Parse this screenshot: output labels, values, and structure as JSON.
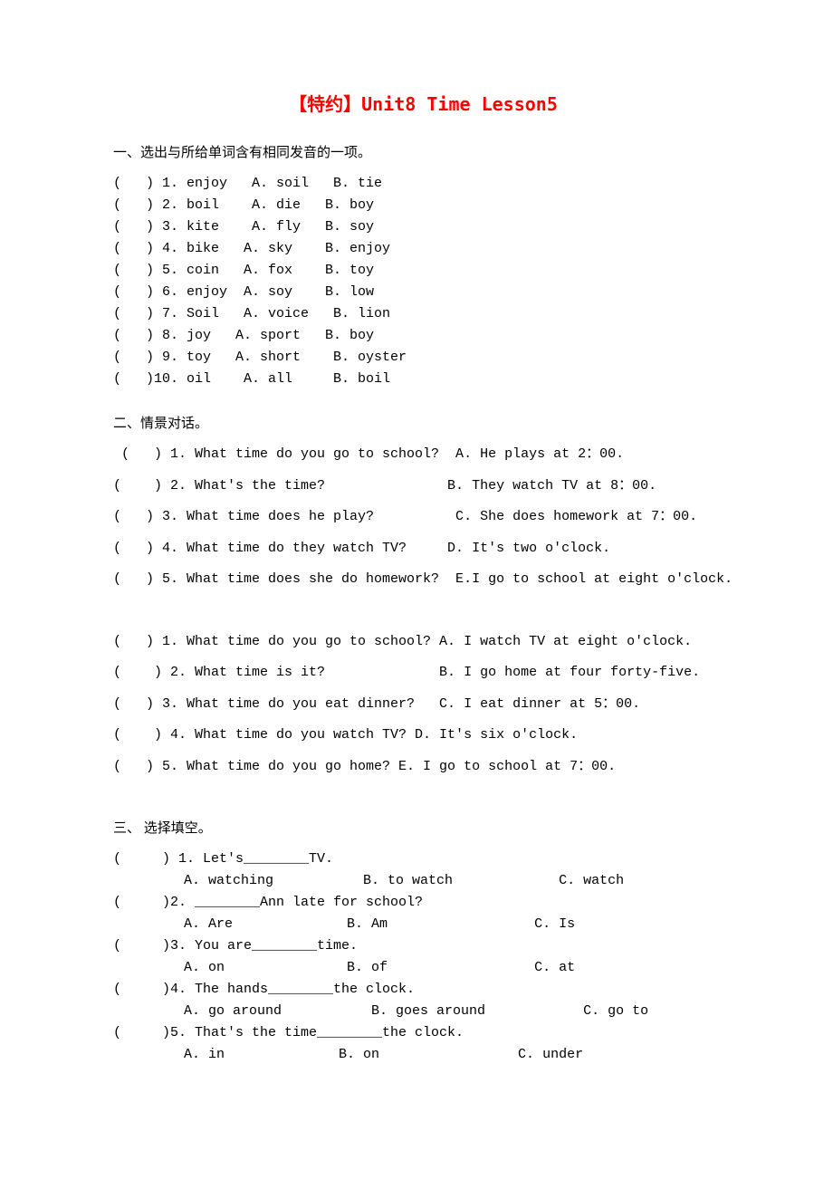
{
  "title": "【特约】Unit8 Time Lesson5",
  "section1": {
    "heading": "一、选出与所给单词含有相同发音的一项。",
    "rows": [
      "(   ) 1. enjoy   A. soil   B. tie",
      "(   ) 2. boil    A. die   B. boy",
      "(   ) 3. kite    A. fly   B. soy",
      "(   ) 4. bike   A. sky    B. enjoy",
      "(   ) 5. coin   A. fox    B. toy",
      "(   ) 6. enjoy  A. soy    B. low",
      "(   ) 7. Soil   A. voice   B. lion",
      "(   ) 8. joy   A. sport   B. boy",
      "(   ) 9. toy   A. short    B. oyster",
      "(   )10. oil    A. all     B. boil"
    ]
  },
  "section2": {
    "heading": "二、情景对话。",
    "groupA": [
      " (   ) 1. What time do you go to school?  A. He plays at 2：00.",
      "(    ) 2. What's the time?               B. They watch TV at 8：00.",
      "(   ) 3. What time does he play?          C. She does homework at 7：00.",
      "(   ) 4. What time do they watch TV?     D. It's two o'clock.",
      "(   ) 5. What time does she do homework?  E.I go to school at eight o'clock."
    ],
    "groupB": [
      "(   ) 1. What time do you go to school? A. I watch TV at eight o'clock.",
      "(    ) 2. What time is it?              B. I go home at four forty-five.",
      "(   ) 3. What time do you eat dinner?   C. I eat dinner at 5：00.",
      "(    ) 4. What time do you watch TV? D. It's six o'clock.",
      "(   ) 5. What time do you go home? E. I go to school at 7：00."
    ]
  },
  "section3": {
    "heading": "三、 选择填空。",
    "items": [
      {
        "stem": "(     ) 1. Let's________TV.",
        "opts": "A. watching           B. to watch             C. watch"
      },
      {
        "stem": "(     )2. ________Ann late for school?",
        "opts": "A. Are              B. Am                  C. Is"
      },
      {
        "stem": "(     )3. You are________time.",
        "opts": "A. on               B. of                  C. at"
      },
      {
        "stem": "(     )4. The hands________the clock.",
        "opts": "A. go around           B. goes around            C. go to"
      },
      {
        "stem": "(     )5. That's the time________the clock.",
        "opts": "A. in              B. on                 C. under"
      }
    ]
  }
}
